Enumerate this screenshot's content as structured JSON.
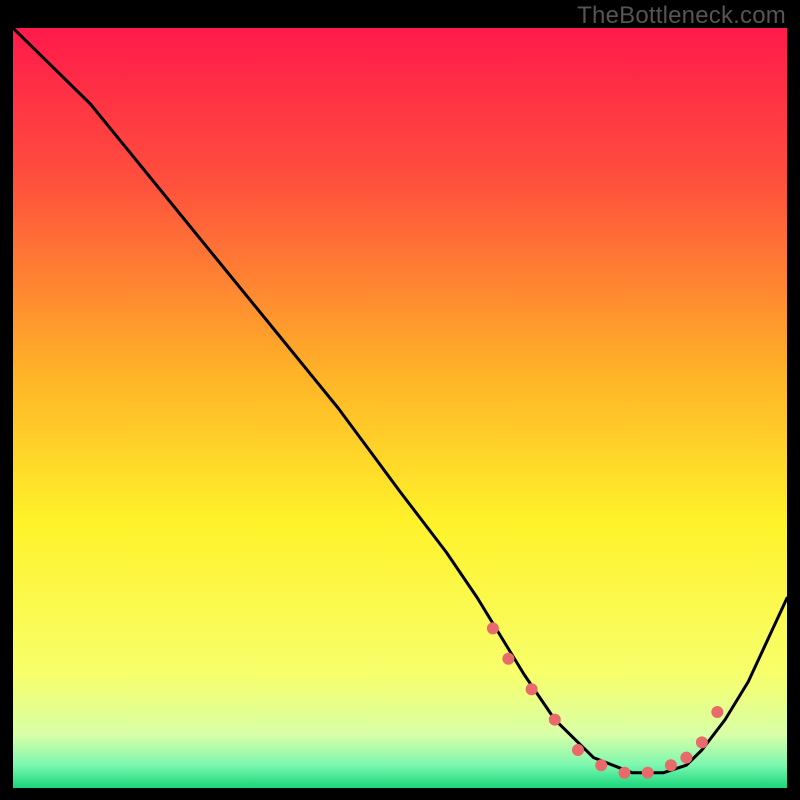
{
  "watermark": "TheBottleneck.com",
  "chart_data": {
    "type": "line",
    "title": "",
    "xlabel": "",
    "ylabel": "",
    "xlim": [
      0,
      100
    ],
    "ylim": [
      0,
      100
    ],
    "grid": false,
    "legend": false,
    "background_gradient": [
      {
        "pos": 0.0,
        "color": "#ff1a4b"
      },
      {
        "pos": 0.2,
        "color": "#ff4f3d"
      },
      {
        "pos": 0.45,
        "color": "#ffb128"
      },
      {
        "pos": 0.65,
        "color": "#fff22a"
      },
      {
        "pos": 0.85,
        "color": "#f7ff6b"
      },
      {
        "pos": 0.93,
        "color": "#d8ffa7"
      },
      {
        "pos": 0.97,
        "color": "#7cf7b0"
      },
      {
        "pos": 1.0,
        "color": "#17d67a"
      }
    ],
    "series": [
      {
        "name": "bottleneck-curve",
        "color": "#000000",
        "x": [
          0,
          3,
          6,
          10,
          18,
          26,
          34,
          42,
          50,
          56,
          60,
          63,
          66,
          70,
          75,
          80,
          84,
          87,
          89,
          92,
          95,
          100
        ],
        "values": [
          100,
          97,
          94,
          90,
          80,
          70,
          60,
          50,
          39,
          31,
          25,
          20,
          15,
          9,
          4,
          2,
          2,
          3,
          5,
          9,
          14,
          25
        ]
      }
    ],
    "markers": {
      "name": "optimal-range-dots",
      "color": "#e86a6a",
      "x": [
        62,
        64,
        67,
        70,
        73,
        76,
        79,
        82,
        85,
        87,
        89,
        91
      ],
      "values": [
        21,
        17,
        13,
        9,
        5,
        3,
        2,
        2,
        3,
        4,
        6,
        10
      ]
    }
  }
}
